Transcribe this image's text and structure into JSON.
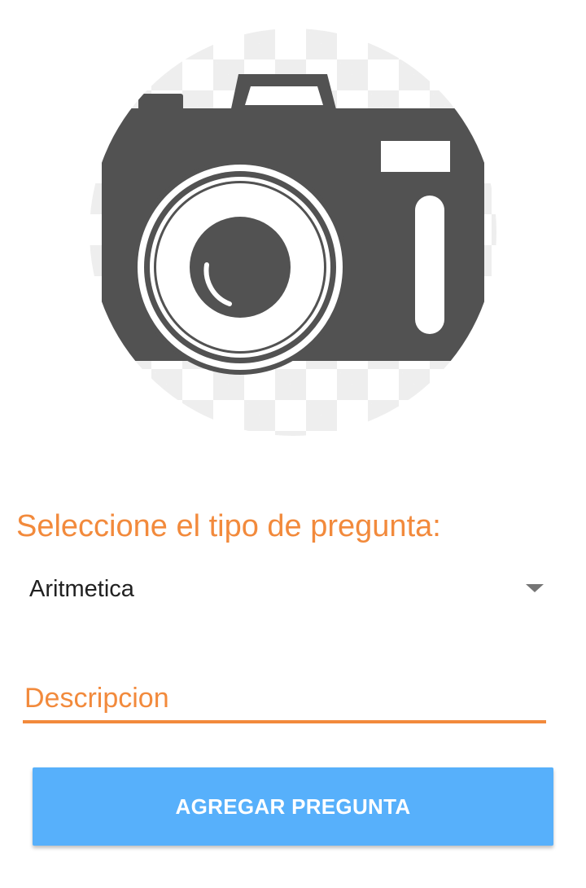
{
  "image_picker": {
    "icon": "camera-icon"
  },
  "question_type": {
    "label": "Seleccione el tipo de pregunta:",
    "selected": "Aritmetica"
  },
  "description": {
    "placeholder": "Descripcion",
    "value": ""
  },
  "add_button": {
    "label": "AGREGAR PREGUNTA"
  },
  "colors": {
    "accent": "#f28a3c",
    "button_bg": "#57b0fb",
    "icon": "#525252"
  }
}
